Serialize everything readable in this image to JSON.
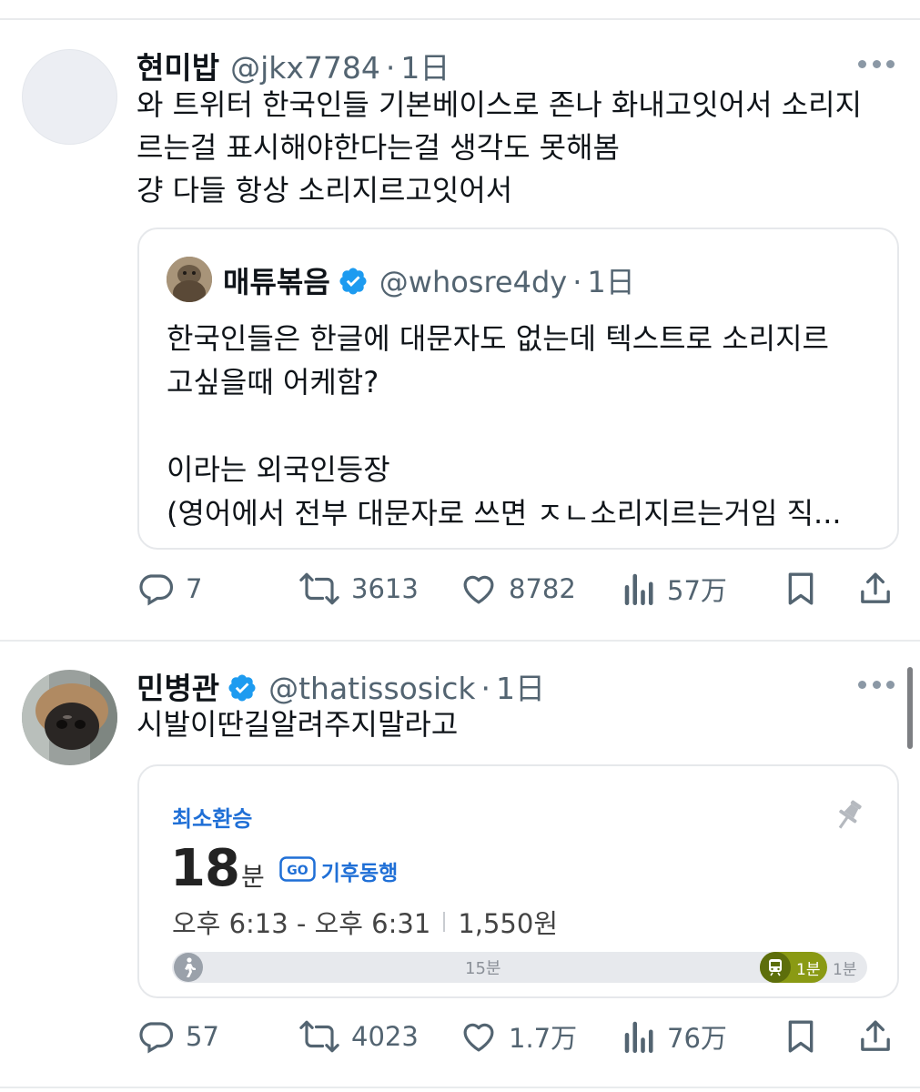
{
  "tweets": [
    {
      "author_name": "현미밥",
      "handle": "@jkx7784",
      "separator": "·",
      "time": "1日",
      "text_lines": [
        "와 트위터 한국인들 기본베이스로 존나 화내고잇어서 소리지",
        "르는걸 표시해야한다는걸 생각도 못해봄",
        "걍 다들 항상 소리지르고잇어서"
      ],
      "quote": {
        "author_name": "매튜볶음",
        "verified": true,
        "handle": "@whosre4dy",
        "separator": "·",
        "time": "1日",
        "text_lines": [
          "한국인들은 한글에 대문자도 없는데 텍스트로 소리지르",
          "고싶을때 어케함?",
          "",
          "이라는 외국인등장",
          "(영어에서 전부 대문자로 쓰면 ㅈㄴ소리지르는거임 직..."
        ]
      },
      "actions": {
        "replies": "7",
        "retweets": "3613",
        "likes": "8782",
        "views": "57万"
      }
    },
    {
      "author_name": "민병관",
      "verified": true,
      "handle": "@thatissosick",
      "separator": "·",
      "time": "1日",
      "text_lines": [
        "시발이딴길알려주지말라고"
      ],
      "card": {
        "route_label": "최소환승",
        "duration_number": "18",
        "duration_unit": "분",
        "climate_badge": "기후동행",
        "time_range": "오후 6:13 - 오후 6:31",
        "fare": "1,550원",
        "walk_segment_label": "15분",
        "train_segment_label": "1분",
        "end_segment_label": "1분"
      },
      "actions": {
        "replies": "57",
        "retweets": "4023",
        "likes": "1.7万",
        "views": "76万"
      }
    }
  ],
  "icons": {
    "reply": "reply-icon",
    "retweet": "retweet-icon",
    "like": "like-icon",
    "views": "views-icon",
    "bookmark": "bookmark-icon",
    "share": "share-icon",
    "more": "more-icon",
    "verified": "verified-badge-icon"
  },
  "colors": {
    "verified": "#1d9bf0",
    "secondary_text": "#536471",
    "route_blue": "#1f6fd6",
    "train_green": "#8a9a14"
  }
}
